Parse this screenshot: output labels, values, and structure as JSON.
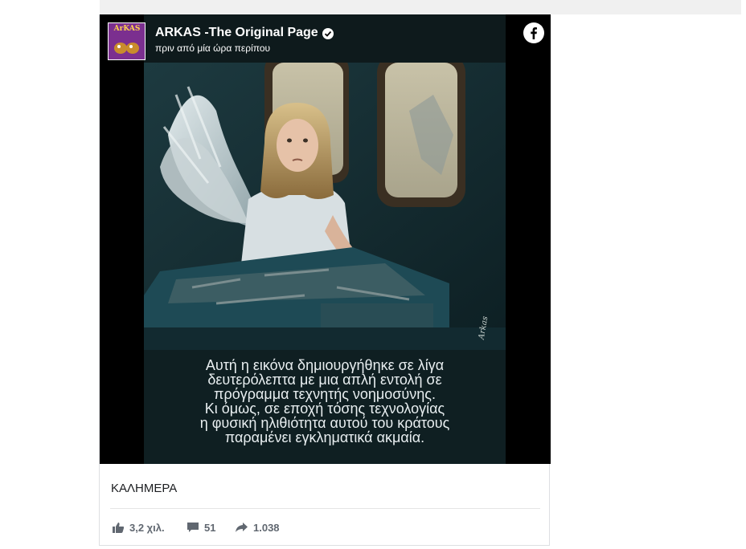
{
  "post": {
    "page_name": "ARKAS -The Original Page",
    "timestamp": "πριν από μία ώρα περίπου",
    "avatar_text": "ArKAS",
    "image_caption": "Αυτή η εικόνα δημιουργήθηκε σε λίγα\nδευτερόλεπτα με μια απλή εντολή σε\nπρόγραμμα τεχνητής νοημοσύνης.\nΚι όμως, σε εποχή τόσης τεχνολογίας\nη φυσική ηλιθιότητα αυτού του κράτους\nπαραμένει εγκληματικά ακμαία.",
    "image_signature": "Arkas",
    "text": "ΚΑΛΗΜΕΡΑ",
    "likes": "3,2 χιλ.",
    "comments": "51",
    "shares": "1.038"
  },
  "icons": {
    "verified": "verified-badge-icon",
    "facebook": "facebook-logo-icon",
    "like": "thumbs-up-icon",
    "comment": "comment-bubble-icon",
    "share": "share-arrow-icon"
  },
  "colors": {
    "meta_text": "#606770",
    "card_border": "#dddfe2",
    "avatar_bg": "#7b2f8f"
  }
}
